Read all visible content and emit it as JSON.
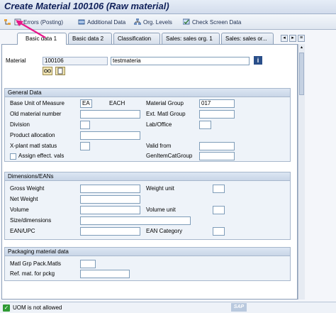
{
  "window": {
    "title": "Create Material 100106 (Raw material)"
  },
  "toolbar": {
    "errors": "Errors (Posting)",
    "additional_data": "Additional Data",
    "org_levels": "Org. Levels",
    "check_screen_data": "Check Screen Data"
  },
  "tabs": [
    "Basic data 1",
    "Basic data 2",
    "Classification",
    "Sales: sales org. 1",
    "Sales: sales or..."
  ],
  "header": {
    "material_label": "Material",
    "material_value": "100106",
    "description_value": "testmateria"
  },
  "general_data": {
    "title": "General Data",
    "base_uom_label": "Base Unit of Measure",
    "base_uom_value": "EA",
    "base_uom_text": "EACH",
    "material_group_label": "Material Group",
    "material_group_value": "017",
    "old_material_label": "Old material number",
    "ext_matl_group_label": "Ext. Matl Group",
    "division_label": "Division",
    "lab_office_label": "Lab/Office",
    "product_allocation_label": "Product allocation",
    "xplant_status_label": "X-plant matl status",
    "valid_from_label": "Valid from",
    "assign_effect_label": "Assign effect. vals",
    "gen_item_cat_label": "GenItemCatGroup"
  },
  "dimensions": {
    "title": "Dimensions/EANs",
    "gross_weight_label": "Gross Weight",
    "weight_unit_label": "Weight unit",
    "net_weight_label": "Net Weight",
    "volume_label": "Volume",
    "volume_unit_label": "Volume unit",
    "size_dimensions_label": "Size/dimensions",
    "ean_upc_label": "EAN/UPC",
    "ean_category_label": "EAN Category"
  },
  "packaging": {
    "title": "Packaging material data",
    "matl_grp_pack_label": "Matl Grp Pack.Matls",
    "ref_mat_label": "Ref. mat. for pckg"
  },
  "status_bar": {
    "message": "UOM is not allowed",
    "logo": "SAP"
  },
  "colors": {
    "accent": "#e8178a",
    "status_ok": "#2f9a34",
    "title_text": "#10215a"
  }
}
